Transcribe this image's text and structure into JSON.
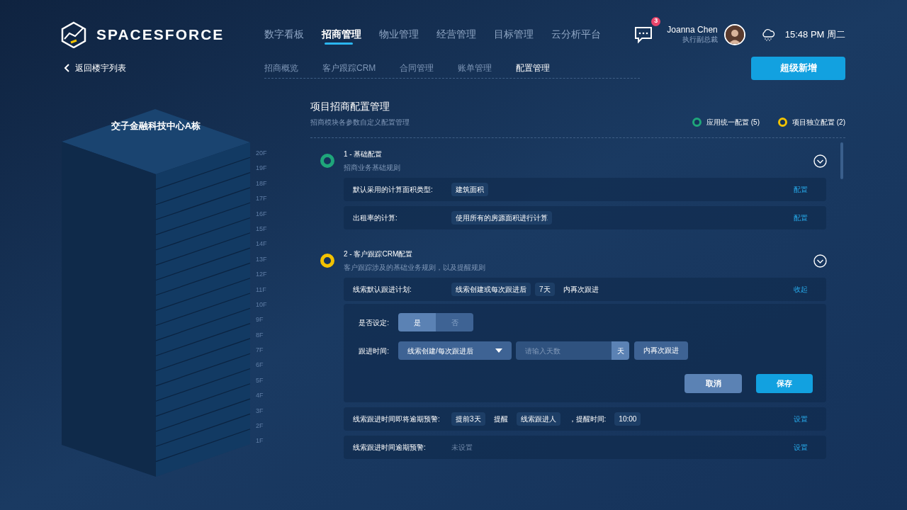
{
  "header": {
    "logo": "SPACESFORCE",
    "nav": [
      {
        "label": "数字看板",
        "selected": false
      },
      {
        "label": "招商管理",
        "selected": true
      },
      {
        "label": "物业管理",
        "selected": false
      },
      {
        "label": "经营管理",
        "selected": false
      },
      {
        "label": "目标管理",
        "selected": false
      },
      {
        "label": "云分析平台",
        "selected": false
      }
    ],
    "notification_count": "3",
    "user": {
      "name": "Joanna Chen",
      "role": "执行副总裁"
    },
    "clock": "15:48 PM 周二"
  },
  "subnav": {
    "back": "返回楼宇列表",
    "tabs": [
      {
        "label": "招商概览",
        "selected": false
      },
      {
        "label": "客户跟踪CRM",
        "selected": false
      },
      {
        "label": "合同管理",
        "selected": false
      },
      {
        "label": "账单管理",
        "selected": false
      },
      {
        "label": "配置管理",
        "selected": true
      }
    ],
    "action": "超级新增"
  },
  "building": {
    "name": "交子金融科技中心A栋",
    "floors": [
      "20F",
      "19F",
      "18F",
      "17F",
      "16F",
      "15F",
      "14F",
      "13F",
      "12F",
      "11F",
      "10F",
      "9F",
      "8F",
      "7F",
      "6F",
      "5F",
      "4F",
      "3F",
      "2F",
      "1F"
    ]
  },
  "panel": {
    "title": "项目招商配置管理",
    "subtitle": "招商模块各参数自定义配置管理",
    "legend": [
      {
        "label": "应用统一配置 (5)",
        "color": "#1fa67a"
      },
      {
        "label": "项目独立配置 (2)",
        "color": "#f2c200"
      }
    ],
    "sections": [
      {
        "title": "1 - 基础配置",
        "subtitle": "招商业务基础规则",
        "color": "#1fa67a",
        "rows": [
          {
            "label": "默认采用的计算面积类型:",
            "parts": [
              {
                "kind": "chip",
                "text": "建筑面积"
              }
            ],
            "action": "配置"
          },
          {
            "label": "出租率的计算:",
            "parts": [
              {
                "kind": "chip",
                "text": "使用所有的房源面积进行计算"
              }
            ],
            "action": "配置"
          }
        ]
      },
      {
        "title": "2 - 客户跟踪CRM配置",
        "subtitle": "客户跟踪涉及的基础业务规则，以及提醒规则",
        "color": "#f2c200",
        "rows": [
          {
            "label": "线索默认跟进计划:",
            "parts": [
              {
                "kind": "chip",
                "text": "线索创建或每次跟进后"
              },
              {
                "kind": "chip",
                "text": "7天"
              },
              {
                "kind": "text",
                "text": "内再次跟进"
              }
            ],
            "action": "收起",
            "editor": {
              "toggle_label": "是否设定:",
              "options": [
                {
                  "label": "是",
                  "selected": true
                },
                {
                  "label": "否",
                  "selected": false
                }
              ],
              "time_label": "跟进时间:",
              "select": "线索创建/每次跟进后",
              "input_placeholder": "请输入天数",
              "unit": "天",
              "suffix": "内再次跟进",
              "cancel": "取消",
              "save": "保存"
            }
          },
          {
            "label": "线索跟进时间即将逾期预警:",
            "parts": [
              {
                "kind": "chip",
                "text": "提前3天"
              },
              {
                "kind": "text",
                "text": "提醒"
              },
              {
                "kind": "chip",
                "text": "线索跟进人"
              },
              {
                "kind": "text",
                "text": "，提醒时间:"
              },
              {
                "kind": "chip",
                "text": "10:00"
              }
            ],
            "action": "设置"
          },
          {
            "label": "线索跟进时间逾期预警:",
            "parts": [
              {
                "kind": "muted",
                "text": "未设置"
              }
            ],
            "action": "设置"
          }
        ]
      }
    ]
  }
}
